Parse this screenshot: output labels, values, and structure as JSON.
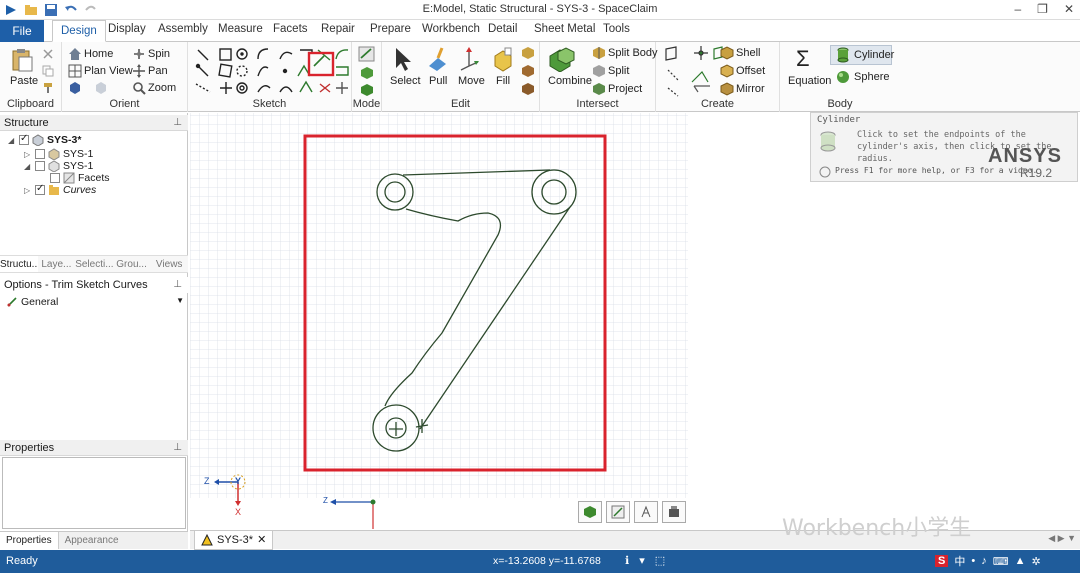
{
  "window": {
    "title": "E:Model, Static Structural - SYS-3 - SpaceClaim"
  },
  "ribbon": {
    "file_tab": "File",
    "tabs": [
      "Design",
      "Display",
      "Assembly",
      "Measure",
      "Facets",
      "Repair",
      "Prepare",
      "Workbench",
      "Detail",
      "Sheet Metal",
      "Tools"
    ],
    "groups": {
      "clipboard": {
        "label": "Clipboard",
        "paste": "Paste"
      },
      "orient": {
        "label": "Orient",
        "home": "Home",
        "spin": "Spin",
        "plan_view": "Plan View",
        "pan": "Pan",
        "zoom": "Zoom"
      },
      "sketch": {
        "label": "Sketch"
      },
      "mode": {
        "label": "Mode"
      },
      "edit": {
        "label": "Edit",
        "select": "Select",
        "pull": "Pull",
        "move": "Move",
        "fill": "Fill"
      },
      "intersect": {
        "label": "Intersect",
        "combine": "Combine",
        "split_body": "Split Body",
        "split": "Split",
        "project": "Project"
      },
      "create": {
        "label": "Create",
        "shell": "Shell",
        "offset": "Offset",
        "mirror": "Mirror"
      },
      "body": {
        "label": "Body",
        "equation": "Equation",
        "cylinder": "Cylinder",
        "sphere": "Sphere"
      }
    }
  },
  "structure": {
    "header": "Structure",
    "tree": [
      {
        "label": "SYS-3*"
      },
      {
        "label": "SYS-1"
      },
      {
        "label": "SYS-1"
      },
      {
        "label": "Facets"
      },
      {
        "label": "Curves"
      }
    ],
    "subtabs": [
      "Structu...",
      "Laye...",
      "Selecti...",
      "Grou...",
      "Views"
    ]
  },
  "options": {
    "header": "Options - Trim Sketch Curves",
    "general": "General"
  },
  "properties": {
    "header": "Properties"
  },
  "left_bottom_tabs": [
    "Properties",
    "Appearance"
  ],
  "tooltip": {
    "title": "Cylinder",
    "description": "Click to set the endpoints of the cylinder's axis, then click to set the radius.",
    "help": "Press F1 for more help, or F3 for a video."
  },
  "brand": {
    "name": "ANSYS",
    "release": "R19.2"
  },
  "axes": {
    "triad_z": "Z",
    "triad_y": "Y",
    "triad_x": "X",
    "plane_z": "Z"
  },
  "doc_tab": {
    "label": "SYS-3*"
  },
  "status": {
    "text": "Ready",
    "coords": "x=-13.2608  y=-11.6768"
  },
  "watermark": "Workbench小学生",
  "ime": {
    "lang": "中"
  },
  "colors": {
    "accent": "#1e5fa8",
    "status_bar": "#1f5c9b",
    "highlight": "#d9232d",
    "sketch_line": "#2d4a2d",
    "grid": "#d9dde6"
  }
}
